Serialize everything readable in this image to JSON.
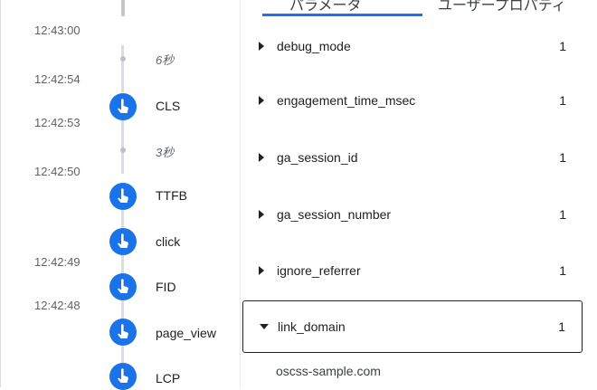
{
  "timeline": {
    "timestamps": [
      "12:43:00",
      "12:42:54",
      "12:42:53",
      "12:42:50",
      "12:42:49",
      "12:42:48"
    ],
    "gaps": [
      "6秒",
      "3秒"
    ],
    "events": [
      "CLS",
      "TTFB",
      "click",
      "FID",
      "page_view",
      "LCP"
    ],
    "icon": "touch-hand-icon",
    "icon_color": "#1a73e8"
  },
  "tabs": [
    "パラメータ",
    "ユーザープロパティ"
  ],
  "params": [
    {
      "name": "debug_mode",
      "count": "1"
    },
    {
      "name": "engagement_time_msec",
      "count": "1"
    },
    {
      "name": "ga_session_id",
      "count": "1"
    },
    {
      "name": "ga_session_number",
      "count": "1"
    },
    {
      "name": "ignore_referrer",
      "count": "1"
    },
    {
      "name": "link_domain",
      "count": "1"
    }
  ],
  "expanded_value": "oscss-sample.com"
}
